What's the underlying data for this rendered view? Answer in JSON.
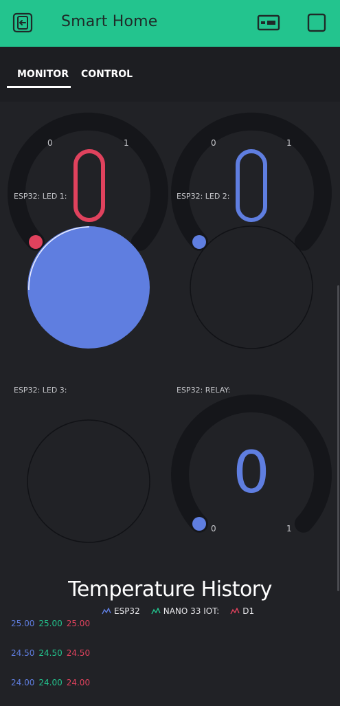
{
  "app": {
    "title": "Smart Home"
  },
  "tabs": [
    {
      "label": "MONITOR"
    },
    {
      "label": "CONTROL"
    }
  ],
  "gauges_top": [
    {
      "min": "0",
      "max": "1",
      "color": "#e0425d"
    },
    {
      "min": "0",
      "max": "1",
      "color": "#5f7ee0"
    }
  ],
  "leds": [
    {
      "label": "ESP32: LED 1:",
      "on": true
    },
    {
      "label": "ESP32: LED 2:",
      "on": false
    },
    {
      "label": "ESP32: LED 3:",
      "on": false
    }
  ],
  "relay": {
    "label": "ESP32: RELAY:",
    "value": "0",
    "min": "0",
    "max": "1",
    "color": "#5f7ee0"
  },
  "chart_data": {
    "type": "line",
    "title": "Temperature History",
    "series": [
      {
        "name": "ESP32",
        "color": "#5f7ee0"
      },
      {
        "name": "NANO 33 IOT:",
        "color": "#23c48e"
      },
      {
        "name": "D1",
        "color": "#e0425d"
      }
    ],
    "y_ticks": [
      [
        "25.00",
        "25.00",
        "25.00"
      ],
      [
        "24.50",
        "24.50",
        "24.50"
      ],
      [
        "24.00",
        "24.00",
        "24.00"
      ]
    ]
  },
  "colors": {
    "accent": "#23c48e",
    "background": "#212226",
    "led_on": "#5f7ee0"
  }
}
